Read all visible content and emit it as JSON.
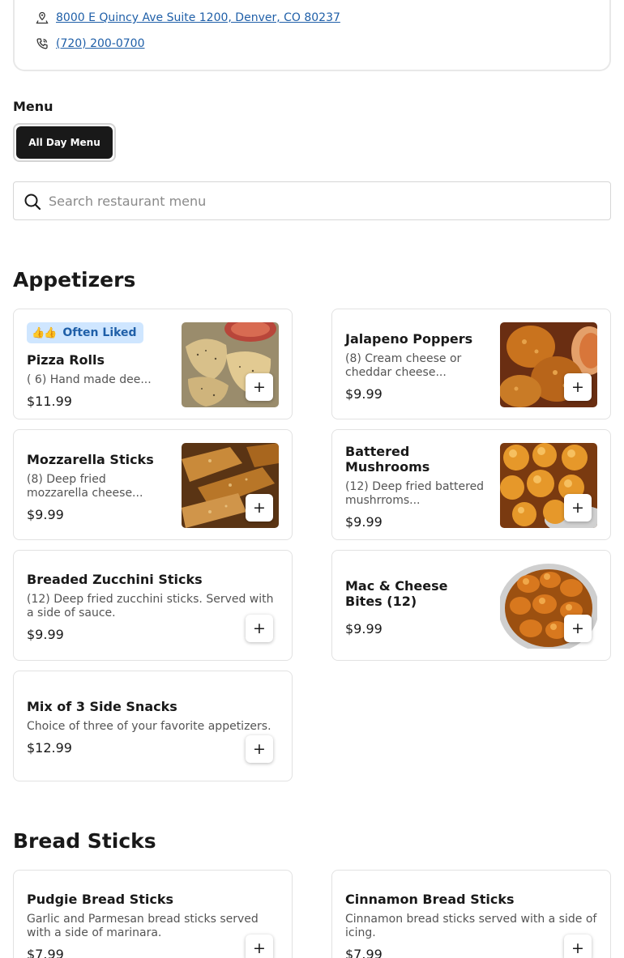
{
  "restaurant": {
    "address": "8000 E Quincy Ave Suite 1200, Denver, CO 80237",
    "phone": "(720) 200-0700"
  },
  "menu": {
    "label": "Menu",
    "active_menu": "All Day Menu"
  },
  "search": {
    "placeholder": "Search restaurant menu"
  },
  "sections": [
    {
      "title": "Appetizers",
      "items": [
        {
          "badge": "Often Liked",
          "badge_icon": "thumbs-up-icon",
          "name": "Pizza Rolls",
          "desc": "( 6) Hand made dee...",
          "price": "$11.99"
        },
        {
          "name": "Jalapeno Poppers",
          "desc": "(8) Cream cheese or cheddar cheese...",
          "price": "$9.99"
        },
        {
          "name": "Mozzarella Sticks",
          "desc": "(8) Deep fried mozzarella cheese...",
          "price": "$9.99"
        },
        {
          "name": "Battered Mushrooms",
          "desc": "(12) Deep fried battered mushrroms...",
          "price": "$9.99"
        },
        {
          "name": "Breaded Zucchini Sticks",
          "desc": "(12) Deep fried zucchini sticks. Served with a side of sauce.",
          "price": "$9.99"
        },
        {
          "name": "Mac & Cheese Bites (12)",
          "price": "$9.99"
        },
        {
          "name": "Mix of 3 Side Snacks",
          "desc": "Choice of three of your favorite appetizers.",
          "price": "$12.99"
        }
      ]
    },
    {
      "title": "Bread Sticks",
      "items": [
        {
          "name": "Pudgie Bread Sticks",
          "desc": "Garlic and Parmesan bread sticks served with a side of marinara.",
          "price": "$7.99"
        },
        {
          "name": "Cinnamon Bread Sticks",
          "desc": "Cinnamon bread sticks served with a side of icing.",
          "price": "$7.99"
        }
      ]
    }
  ],
  "add_button_label": "+",
  "colors": {
    "link": "#1f5fa8",
    "badge_bg": "#cfe6ff",
    "badge_text": "#1f5fa8",
    "chip_bg": "#191919"
  }
}
